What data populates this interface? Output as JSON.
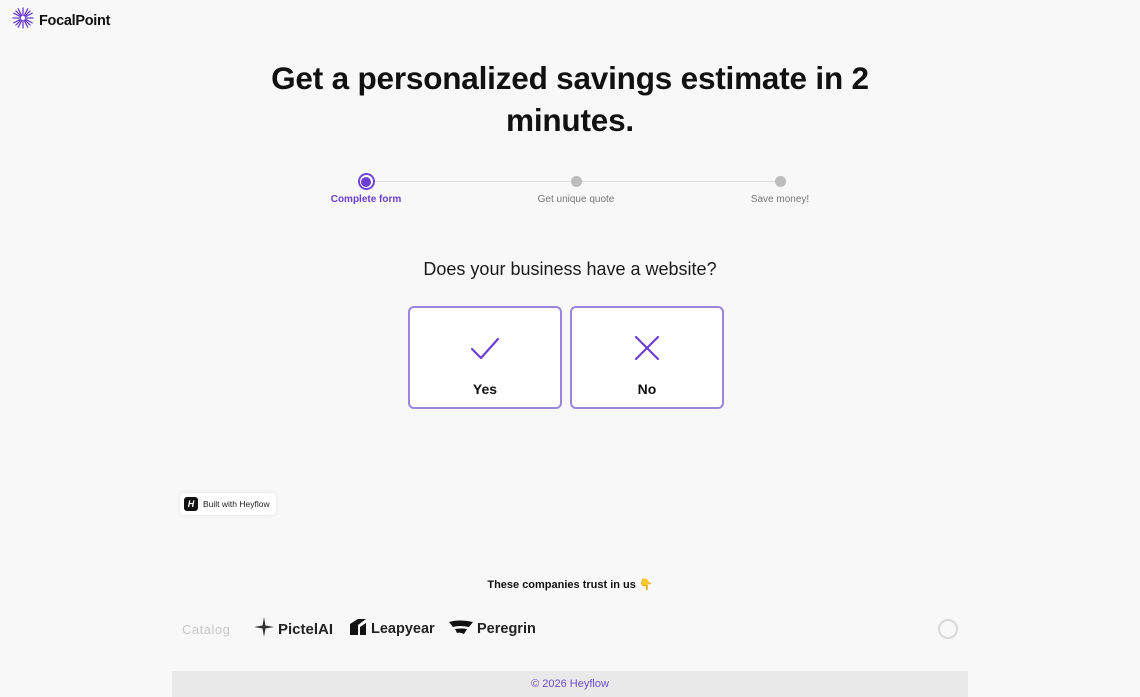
{
  "brand": {
    "name": "FocalPoint",
    "accent_color": "#6a3fd1"
  },
  "headline": "Get a personalized savings estimate in 2 minutes.",
  "stepper": {
    "steps": [
      {
        "label": "Complete form",
        "state": "active"
      },
      {
        "label": "Get unique quote",
        "state": "inactive"
      },
      {
        "label": "Save money!",
        "state": "inactive"
      }
    ]
  },
  "question": "Does your business have a website?",
  "options": [
    {
      "label": "Yes",
      "icon": "checkmark-icon"
    },
    {
      "label": "No",
      "icon": "x-icon"
    }
  ],
  "badge": {
    "text": "Built with Heyflow",
    "icon": "heyflow-h-icon"
  },
  "trust": {
    "heading": "These companies trust in us 👇",
    "companies": [
      {
        "name": "Catalog",
        "style": "faded"
      },
      {
        "name": "PictelAI",
        "icon": "sparkle-icon"
      },
      {
        "name": "Leapyear",
        "icon": "leapyear-icon"
      },
      {
        "name": "Peregrin",
        "icon": "peregrin-icon"
      }
    ]
  },
  "footer": {
    "text": "© 2026 Heyflow"
  }
}
